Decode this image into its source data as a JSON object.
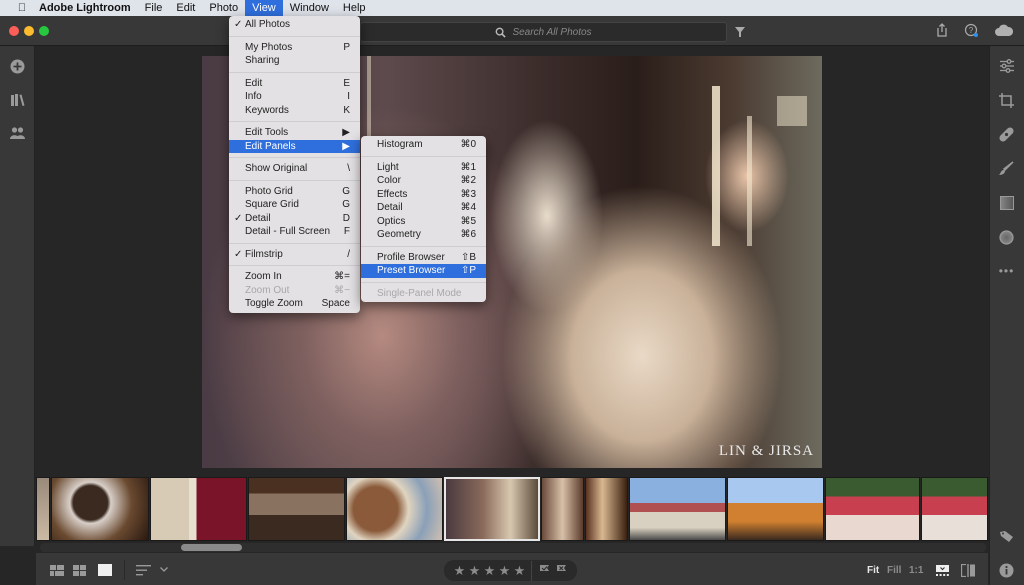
{
  "menubar": {
    "apple_icon": "",
    "app_name": "Adobe Lightroom",
    "items": [
      "File",
      "Edit",
      "Photo",
      "View",
      "Window",
      "Help"
    ],
    "active": "View"
  },
  "toolbar": {
    "search_placeholder": "Search All Photos",
    "filter_icon": "funnel-icon",
    "share_icon": "share-icon",
    "help_icon": "help-icon",
    "cloud_icon": "cloud-icon"
  },
  "view_menu": {
    "groups": [
      [
        {
          "label": "All Photos",
          "shortcut": "",
          "checked": true
        }
      ],
      [
        {
          "label": "My Photos",
          "shortcut": "P"
        },
        {
          "label": "Sharing",
          "shortcut": ""
        }
      ],
      [
        {
          "label": "Edit",
          "shortcut": "E"
        },
        {
          "label": "Info",
          "shortcut": "I"
        },
        {
          "label": "Keywords",
          "shortcut": "K"
        }
      ],
      [
        {
          "label": "Edit Tools",
          "shortcut": "▶"
        },
        {
          "label": "Edit Panels",
          "shortcut": "▶",
          "highlighted": true
        }
      ],
      [
        {
          "label": "Show Original",
          "shortcut": "\\"
        }
      ],
      [
        {
          "label": "Photo Grid",
          "shortcut": "G"
        },
        {
          "label": "Square Grid",
          "shortcut": "G"
        },
        {
          "label": "Detail",
          "shortcut": "D",
          "checked": true
        },
        {
          "label": "Detail - Full Screen",
          "shortcut": "F"
        }
      ],
      [
        {
          "label": "Filmstrip",
          "shortcut": "/",
          "checked": true
        }
      ],
      [
        {
          "label": "Zoom In",
          "shortcut": "⌘="
        },
        {
          "label": "Zoom Out",
          "shortcut": "⌘−",
          "disabled": true
        },
        {
          "label": "Toggle Zoom",
          "shortcut": "Space"
        }
      ]
    ]
  },
  "edit_panels_menu": {
    "groups": [
      [
        {
          "label": "Histogram",
          "shortcut": "⌘0"
        }
      ],
      [
        {
          "label": "Light",
          "shortcut": "⌘1"
        },
        {
          "label": "Color",
          "shortcut": "⌘2"
        },
        {
          "label": "Effects",
          "shortcut": "⌘3"
        },
        {
          "label": "Detail",
          "shortcut": "⌘4"
        },
        {
          "label": "Optics",
          "shortcut": "⌘5"
        },
        {
          "label": "Geometry",
          "shortcut": "⌘6"
        }
      ],
      [
        {
          "label": "Profile Browser",
          "shortcut": "⇧B"
        },
        {
          "label": "Preset Browser",
          "shortcut": "⇧P",
          "highlighted": true
        }
      ],
      [
        {
          "label": "Single-Panel Mode",
          "shortcut": "",
          "disabled": true
        }
      ]
    ]
  },
  "left_sidebar": [
    "add-icon",
    "library-icon",
    "people-icon"
  ],
  "right_sidebar": [
    "edit-sliders-icon",
    "crop-icon",
    "healing-icon",
    "brush-icon",
    "linear-gradient-icon",
    "radial-gradient-icon",
    "more-icon"
  ],
  "photo": {
    "watermark": "LIN & JIRSA"
  },
  "filmstrip": {
    "count": 12,
    "selected_index": 5
  },
  "bottombar": {
    "view_icons": [
      "photo-grid-icon",
      "square-grid-icon",
      "detail-view-icon"
    ],
    "sort_icon": "sort-icon",
    "rating_stars": 5,
    "rating_value": 0,
    "flags": [
      "pick-flag-icon",
      "reject-flag-icon"
    ],
    "zoom_options": [
      "Fit",
      "Fill",
      "1:1"
    ],
    "zoom_selected": "Fit"
  },
  "colors": {
    "accent": "#2f6fdd",
    "panel": "#383838",
    "background": "#262626"
  }
}
